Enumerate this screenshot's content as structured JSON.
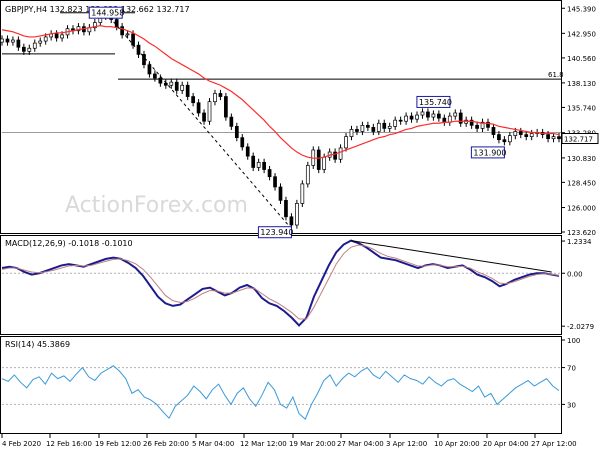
{
  "chart_data": [
    {
      "type": "candlestick",
      "panel": "price",
      "title": "GBPJPY,H4",
      "ohlc_header": "132.823 133.022 132.662 132.717",
      "last_price": "132.717",
      "watermark": "ActionForex.com",
      "ylim": [
        123.62,
        146.0
      ],
      "yticks": [
        "145.390",
        "142.950",
        "140.560",
        "138.130",
        "135.740",
        "133.280",
        "130.830",
        "128.450",
        "126.000",
        "123.620"
      ],
      "ytick_values": [
        145.39,
        142.95,
        140.56,
        138.13,
        135.74,
        133.28,
        130.83,
        128.45,
        126.0,
        123.62
      ],
      "x": [
        "4 Feb 2020",
        "12 Feb 16:00",
        "19 Feb 12:00",
        "26 Feb 20:00",
        "5 Mar 04:00",
        "12 Mar 12:00",
        "19 Mar 20:00",
        "27 Mar 04:00",
        "3 Apr 12:00",
        "10 Apr 20:00",
        "20 Apr 04:00",
        "27 Apr 12:00"
      ],
      "close_series": [
        142.4,
        142.1,
        142.3,
        141.6,
        141.2,
        141.5,
        142.0,
        142.2,
        142.6,
        142.9,
        142.5,
        142.8,
        143.4,
        143.2,
        143.6,
        143.1,
        143.5,
        144.0,
        144.6,
        144.9,
        144.3,
        143.6,
        142.8,
        142.9,
        141.8,
        140.9,
        139.9,
        139.0,
        138.6,
        138.1,
        137.9,
        138.2,
        137.4,
        137.9,
        136.8,
        136.2,
        135.2,
        134.4,
        136.3,
        137.1,
        136.8,
        134.8,
        133.9,
        132.8,
        131.9,
        131.0,
        129.9,
        130.4,
        129.7,
        129.0,
        128.0,
        126.7,
        125.1,
        124.3,
        126.4,
        128.3,
        130.1,
        131.6,
        129.7,
        130.9,
        131.4,
        130.7,
        131.8,
        132.9,
        133.6,
        133.4,
        134.0,
        133.8,
        133.4,
        134.2,
        133.7,
        133.9,
        134.5,
        134.4,
        134.9,
        134.6,
        135.0,
        135.3,
        134.8,
        135.1,
        134.7,
        134.3,
        134.9,
        135.2,
        134.2,
        134.5,
        134.0,
        133.7,
        134.3,
        133.8,
        133.1,
        132.6,
        132.4,
        133.0,
        133.4,
        133.1,
        132.9,
        133.2,
        133.3,
        133.1,
        132.7,
        132.9,
        132.7
      ],
      "moving_average": [
        143.3,
        143.2,
        143.1,
        142.9,
        142.7,
        142.6,
        142.6,
        142.7,
        142.8,
        142.9,
        143.0,
        143.0,
        143.1,
        143.2,
        143.3,
        143.4,
        143.5,
        143.6,
        143.7,
        143.6,
        143.6,
        143.5,
        143.4,
        143.2,
        143.0,
        142.7,
        142.4,
        142.0,
        141.7,
        141.3,
        140.9,
        140.5,
        140.2,
        139.9,
        139.6,
        139.3,
        139.0,
        138.6,
        138.3,
        138.1,
        137.9,
        137.6,
        137.3,
        136.9,
        136.5,
        136.0,
        135.5,
        135.0,
        134.5,
        133.9,
        133.4,
        132.8,
        132.3,
        131.8,
        131.4,
        131.1,
        130.9,
        130.8,
        130.8,
        130.9,
        131.1,
        131.2,
        131.4,
        131.6,
        131.8,
        132.0,
        132.2,
        132.4,
        132.6,
        132.8,
        132.9,
        133.1,
        133.2,
        133.4,
        133.6,
        133.7,
        133.9,
        134.0,
        134.1,
        134.2,
        134.2,
        134.3,
        134.3,
        134.4,
        134.4,
        134.4,
        134.4,
        134.3,
        134.2,
        134.2,
        134.1,
        133.9,
        133.8,
        133.7,
        133.6,
        133.5,
        133.4,
        133.3,
        133.3,
        133.2,
        133.2,
        133.2,
        133.1
      ],
      "annotations": [
        {
          "label": "144.958",
          "index": 19,
          "price": 144.96
        },
        {
          "label": "123.940",
          "index": 53,
          "price": 123.94
        },
        {
          "label": "135.740",
          "index": 79,
          "price": 135.74
        },
        {
          "label": "131.900",
          "index": 92,
          "price": 131.9
        }
      ],
      "fib_label": "61.8",
      "fib_level": 138.5,
      "horizontal_lines": [
        144.96,
        140.95,
        133.3
      ],
      "colors": {
        "price": "#000000",
        "moving_average": "#ff2b2b",
        "fib": "#000000",
        "grid": "#c0c0c0",
        "box": "#1a1aa6"
      }
    },
    {
      "type": "line",
      "panel": "macd",
      "title": "MACD(12,26,9) -0.1018 -0.1010",
      "yticks": [
        "1.2334",
        "0.00",
        "-2.0279"
      ],
      "ytick_values": [
        1.2334,
        0.0,
        -2.0279
      ],
      "ylim": [
        -2.25,
        1.35
      ],
      "series": [
        {
          "name": "",
          "color": "#1b1b8f",
          "values": [
            0.2,
            0.25,
            0.2,
            0.05,
            -0.05,
            0.0,
            0.1,
            0.2,
            0.3,
            0.35,
            0.3,
            0.25,
            0.35,
            0.45,
            0.55,
            0.6,
            0.55,
            0.4,
            0.2,
            -0.1,
            -0.5,
            -0.9,
            -1.15,
            -1.25,
            -1.2,
            -1.0,
            -0.8,
            -0.6,
            -0.55,
            -0.7,
            -0.85,
            -0.75,
            -0.55,
            -0.45,
            -0.6,
            -0.95,
            -1.15,
            -1.25,
            -1.45,
            -1.7,
            -2.0,
            -1.7,
            -0.9,
            -0.3,
            0.3,
            0.8,
            1.1,
            1.25,
            1.15,
            1.0,
            0.8,
            0.6,
            0.55,
            0.5,
            0.4,
            0.3,
            0.2,
            0.3,
            0.35,
            0.3,
            0.2,
            0.25,
            0.3,
            0.15,
            -0.05,
            -0.15,
            -0.3,
            -0.5,
            -0.4,
            -0.25,
            -0.15,
            -0.05,
            0.0,
            0.0,
            -0.05,
            -0.1
          ]
        },
        {
          "name": "",
          "color": "#c08080",
          "values": [
            0.15,
            0.2,
            0.2,
            0.12,
            0.05,
            0.02,
            0.06,
            0.12,
            0.2,
            0.28,
            0.3,
            0.28,
            0.3,
            0.38,
            0.46,
            0.53,
            0.55,
            0.48,
            0.36,
            0.15,
            -0.15,
            -0.5,
            -0.85,
            -1.05,
            -1.12,
            -1.08,
            -0.95,
            -0.78,
            -0.66,
            -0.68,
            -0.76,
            -0.76,
            -0.66,
            -0.56,
            -0.58,
            -0.78,
            -0.98,
            -1.12,
            -1.3,
            -1.5,
            -1.75,
            -1.75,
            -1.3,
            -0.75,
            -0.2,
            0.35,
            0.75,
            1.0,
            1.08,
            1.04,
            0.92,
            0.76,
            0.64,
            0.58,
            0.48,
            0.38,
            0.28,
            0.28,
            0.32,
            0.31,
            0.25,
            0.25,
            0.27,
            0.2,
            0.06,
            -0.06,
            -0.2,
            -0.38,
            -0.4,
            -0.32,
            -0.22,
            -0.12,
            -0.05,
            -0.02,
            -0.04,
            -0.08
          ]
        }
      ],
      "trendline_label": ""
    },
    {
      "type": "line",
      "panel": "rsi",
      "title": "RSI(14) 45.3869",
      "yticks": [
        "100",
        "70",
        "30",
        "0"
      ],
      "ytick_values": [
        100,
        70,
        30,
        0
      ],
      "ylim": [
        0,
        100
      ],
      "series": [
        {
          "name": "",
          "color": "#3a9ad9",
          "values": [
            58,
            55,
            62,
            54,
            48,
            57,
            60,
            52,
            64,
            58,
            61,
            55,
            63,
            70,
            60,
            56,
            64,
            68,
            72,
            66,
            58,
            42,
            46,
            38,
            35,
            30,
            22,
            15,
            28,
            34,
            40,
            50,
            44,
            36,
            46,
            52,
            40,
            30,
            42,
            48,
            36,
            28,
            40,
            54,
            46,
            30,
            26,
            38,
            20,
            14,
            30,
            42,
            56,
            62,
            50,
            58,
            64,
            60,
            66,
            70,
            62,
            58,
            66,
            60,
            54,
            62,
            58,
            56,
            52,
            60,
            54,
            50,
            56,
            58,
            52,
            48,
            44,
            50,
            38,
            42,
            30,
            36,
            42,
            48,
            52,
            56,
            50,
            54,
            58,
            50,
            45
          ]
        }
      ]
    }
  ]
}
